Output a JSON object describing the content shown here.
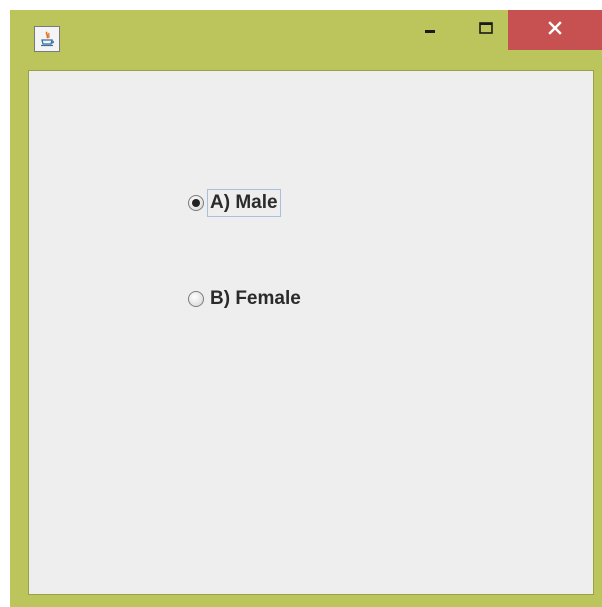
{
  "window": {
    "title": "",
    "close_color": "#c75050",
    "frame_color": "#bcc45c",
    "content_bg": "#eeeeee"
  },
  "titlebar": {
    "app_icon": "java-icon",
    "minimize_icon": "minimize-icon",
    "maximize_icon": "maximize-icon",
    "close_icon": "close-icon"
  },
  "form": {
    "options": [
      {
        "label": "A) Male",
        "selected": true
      },
      {
        "label": "B) Female",
        "selected": false
      }
    ]
  }
}
